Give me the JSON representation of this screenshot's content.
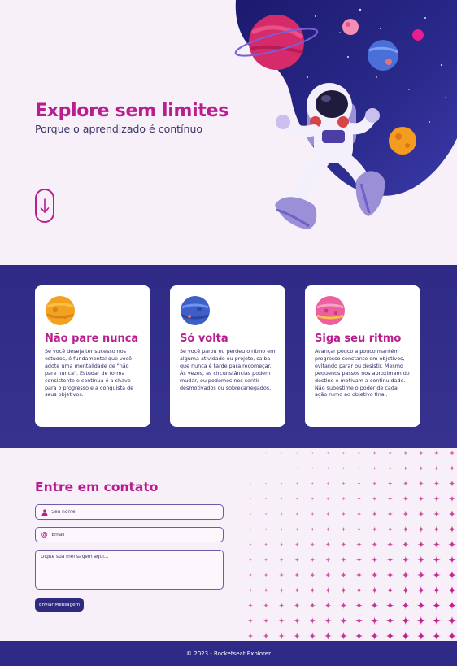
{
  "hero": {
    "title": "Explore sem limites",
    "subtitle": "Porque o aprendizado é contínuo",
    "scroll_icon": "arrow-down-icon",
    "illustration": "astronaut-in-space"
  },
  "cards": [
    {
      "icon": "orange-planet-icon",
      "title": "Não pare nunca",
      "text": "Se você deseja ter sucesso nos estudos, é fundamental que você adote uma mentalidade de \"não pare nunca\". Estudar de forma consistente e contínua é a chave para o progresso e a conquista de seus objetivos."
    },
    {
      "icon": "blue-planet-icon",
      "title": "Só volta",
      "text": "Se você parou ou perdeu o ritmo em alguma atividade ou projeto, saiba que nunca é tarde para recomeçar. Às vezes, as circunstâncias podem mudar, ou podemos nos sentir desmotivados ou sobrecarregados."
    },
    {
      "icon": "pink-planet-icon",
      "title": "Siga seu ritmo",
      "text": "Avançar pouco a pouco mantém progresso constante em objetivos, evitando parar ou desistir. Mesmo pequenos passos nos aproximam do destino e motivam a continuidade. Não subestime o poder de cada ação rumo ao objetivo final."
    }
  ],
  "contact": {
    "title": "Entre em contato",
    "name_placeholder": "Seu nome",
    "email_placeholder": "Email",
    "message_placeholder": "Digite sua mensagem aqui...",
    "submit_label": "Enviar Mensagem"
  },
  "footer": {
    "text": "© 2023 - Rocketseat Explorer"
  },
  "colors": {
    "accent": "#b81e8e",
    "primary": "#2f2a86",
    "background": "#f7f0f8"
  }
}
